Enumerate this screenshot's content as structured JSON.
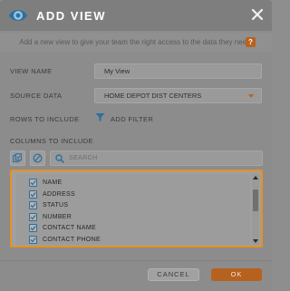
{
  "dialog": {
    "title": "ADD VIEW",
    "description": "Add a new view to give your team the right access to the data they need.",
    "help_badge": "?"
  },
  "form": {
    "view_name_label": "VIEW NAME",
    "view_name_value": "My View",
    "source_data_label": "SOURCE DATA",
    "source_data_value": "HOME DEPOT DIST CENTERS",
    "rows_label": "ROWS TO INCLUDE",
    "add_filter_label": "ADD FILTER",
    "columns_label": "COLUMNS TO INCLUDE"
  },
  "search": {
    "placeholder": "SEARCH"
  },
  "columns": {
    "items": [
      {
        "label": "NAME",
        "checked": true
      },
      {
        "label": "ADDRESS",
        "checked": true
      },
      {
        "label": "STATUS",
        "checked": true
      },
      {
        "label": "NUMBER",
        "checked": true
      },
      {
        "label": "CONTACT NAME",
        "checked": true
      },
      {
        "label": "CONTACT PHONE",
        "checked": true
      }
    ]
  },
  "footer": {
    "cancel_label": "CANCEL",
    "ok_label": "OK"
  },
  "colors": {
    "accent": "#b9621e",
    "focus_border": "#e8911f",
    "checkbox_blue": "#2f6f9c"
  },
  "icons": {
    "logo": "eye-logo-icon",
    "close": "close-icon",
    "filter": "filter-funnel-icon",
    "select_all": "select-all-icon",
    "deselect": "deselect-icon",
    "search": "search-icon"
  }
}
